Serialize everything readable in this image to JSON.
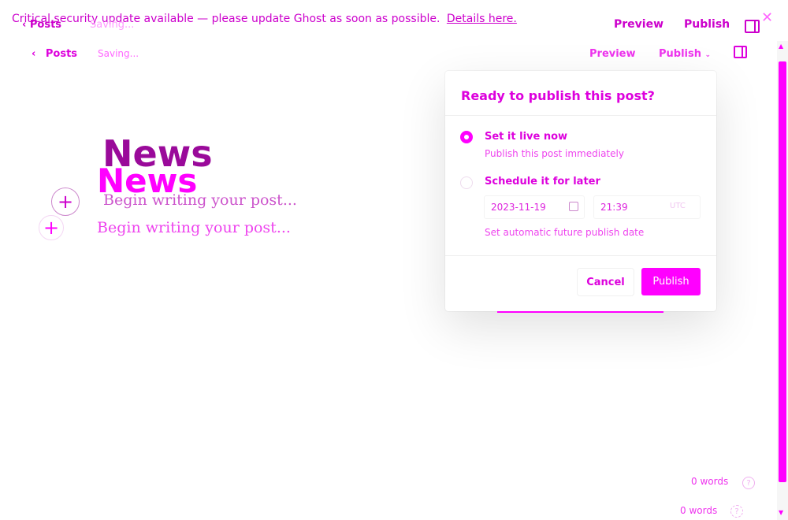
{
  "notice": {
    "text": "Critical security update available — please update Ghost as soon as possible.",
    "link": "Details here."
  },
  "header": {
    "back_label": "Posts",
    "status": "Saving...",
    "preview_label": "Preview",
    "publish_label": "Publish"
  },
  "editor": {
    "title": "News",
    "body_placeholder": "Begin writing your post..."
  },
  "publish_modal": {
    "title": "Ready to publish this post?",
    "options": [
      {
        "label": "Set it live now",
        "description": "Publish this post immediately",
        "selected": true
      },
      {
        "label": "Schedule it for later",
        "description": "Set automatic future publish date",
        "selected": false
      }
    ],
    "date": "2023-11-19",
    "time": "21:39",
    "timezone": "UTC",
    "cancel_label": "Cancel",
    "publish_label": "Publish"
  },
  "footer": {
    "word_count": "0 words",
    "help": "?"
  },
  "colors": {
    "accent": "#ff00ff",
    "ghost_text": "#cc00cc"
  }
}
